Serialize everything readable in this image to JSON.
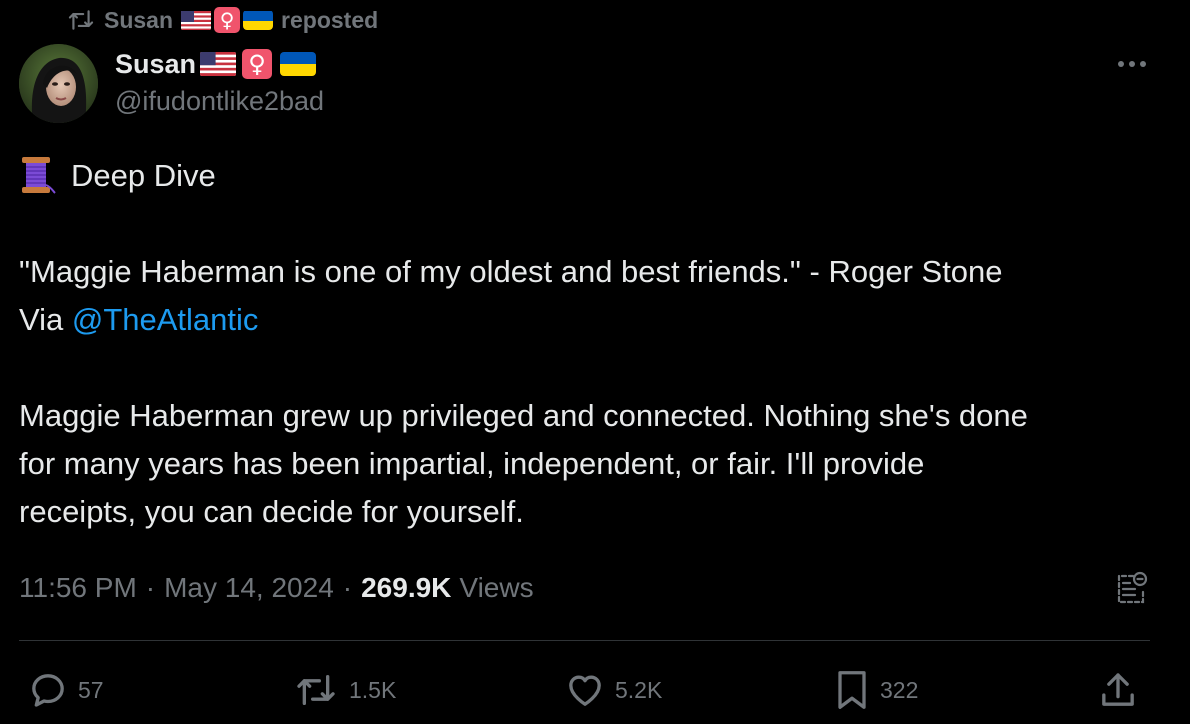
{
  "repost_banner": {
    "name": "Susan",
    "label": "reposted",
    "icon": "repost-icon"
  },
  "author": {
    "display_name": "Susan",
    "handle": "@ifudontlike2bad",
    "badges": [
      "us-flag-emoji",
      "female-sign-emoji",
      "ukraine-flag-emoji"
    ],
    "avatar_icon": "avatar-photo"
  },
  "more_button": {
    "icon": "more-dots-icon"
  },
  "tweet": {
    "lead_emoji": "thread-spool-emoji",
    "heading": "Deep Dive",
    "quote_line": "\"Maggie Haberman is one of my oldest and best friends.\" - Roger Stone",
    "via_text": "Via ",
    "mention": "@TheAtlantic",
    "paragraph_lines": [
      "Maggie Haberman grew up privileged and connected. Nothing she's done",
      "for many years has been impartial, independent, or fair. I'll provide",
      "receipts, you can decide for yourself."
    ]
  },
  "meta": {
    "time": "11:56 PM",
    "separator": "·",
    "date": "May 14, 2024",
    "views_count": "269.9K",
    "views_label": "Views",
    "notes_icon": "community-notes-icon"
  },
  "actions": {
    "replies": {
      "icon": "reply-icon",
      "count": "57"
    },
    "reposts": {
      "icon": "repost-icon",
      "count": "1.5K"
    },
    "likes": {
      "icon": "heart-icon",
      "count": "5.2K"
    },
    "bookmarks": {
      "icon": "bookmark-icon",
      "count": "322"
    },
    "share": {
      "icon": "share-icon"
    }
  },
  "colors": {
    "background": "#000000",
    "text_primary": "#e7e9ea",
    "text_secondary": "#71767b",
    "link": "#1d9bf0",
    "divider": "#2f3336",
    "female_sign_bg": "#f0546c"
  }
}
